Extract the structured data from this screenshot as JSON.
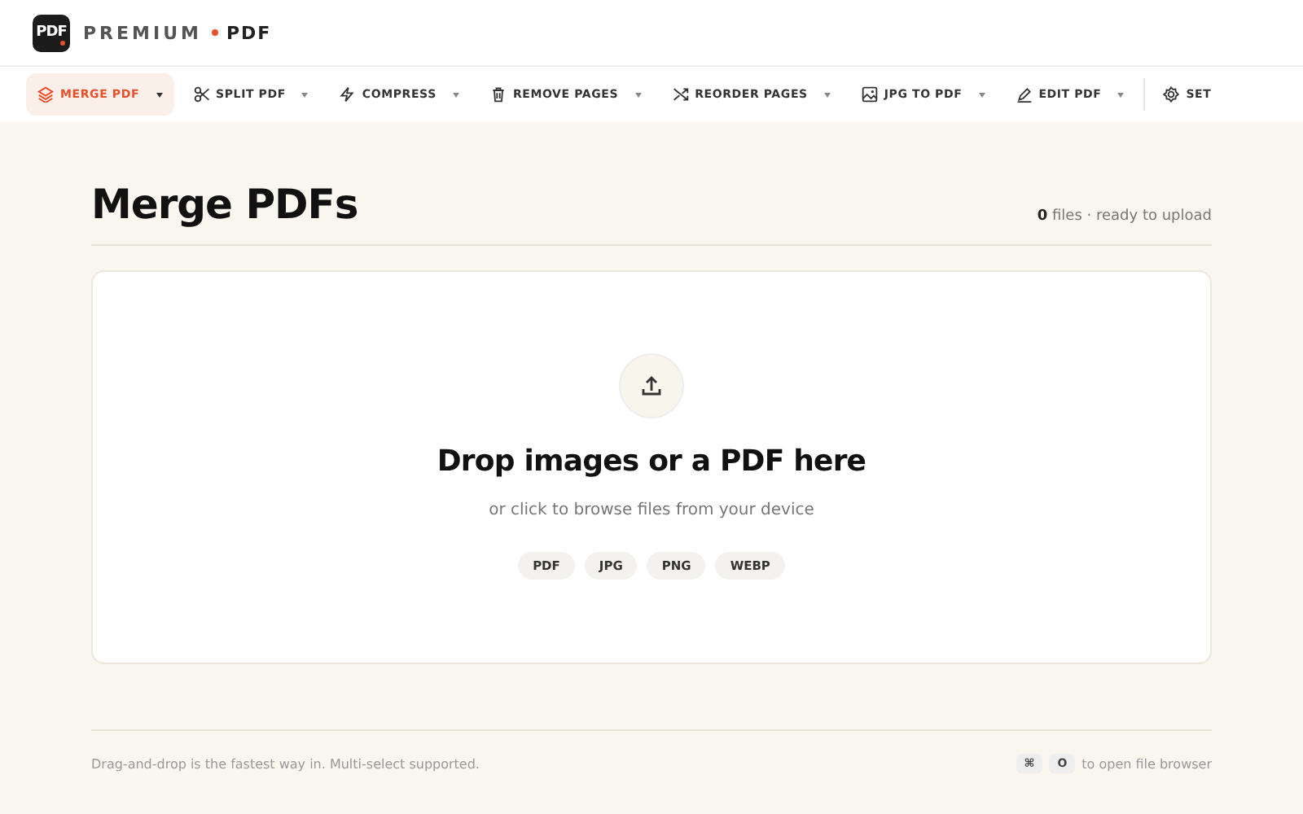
{
  "brand": {
    "logo": "PDF",
    "name": "PREMIUM",
    "suffix": "PDF"
  },
  "nav": [
    {
      "label": "MERGE PDF",
      "selected": true,
      "dropdown": true
    },
    {
      "label": "SPLIT PDF",
      "selected": false,
      "dropdown": true
    },
    {
      "label": "COMPRESS",
      "selected": false,
      "dropdown": true
    },
    {
      "label": "REMOVE PAGES",
      "selected": false,
      "dropdown": true
    },
    {
      "label": "REORDER PAGES",
      "selected": false,
      "dropdown": true
    },
    {
      "label": "JPG TO PDF",
      "selected": false,
      "dropdown": true
    },
    {
      "label": "EDIT PDF",
      "selected": false,
      "dropdown": true
    },
    {
      "label": "SET",
      "selected": false,
      "dropdown": false
    }
  ],
  "page": {
    "title": "Merge PDFs",
    "count": "0",
    "count_text": "files · ready to upload"
  },
  "dropzone": {
    "heading": "Drop images or a PDF here",
    "subtext": "or click to browse files from your device",
    "formats": [
      "PDF",
      "JPG",
      "PNG",
      "WEBP"
    ]
  },
  "footer": {
    "hint": "Drag-and-drop is the fastest way in. Multi-select supported.",
    "keys": [
      "⌘",
      "O"
    ],
    "shortcut_text": "to open file browser"
  }
}
